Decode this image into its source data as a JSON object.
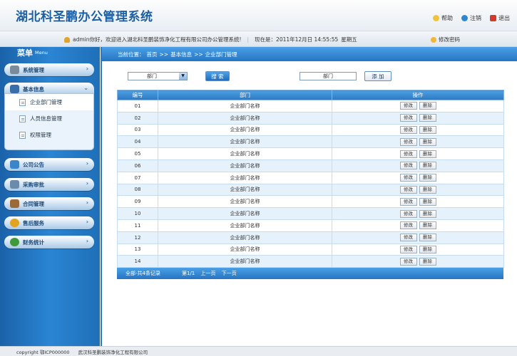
{
  "header": {
    "title": "湖北科圣鹏办公管理系统",
    "links": [
      {
        "label": "帮助",
        "icon": "help-icon"
      },
      {
        "label": "注销",
        "icon": "logout-icon"
      },
      {
        "label": "退出",
        "icon": "exit-icon"
      }
    ]
  },
  "infobar": {
    "welcome": "admin你好，欢迎进入湖北科圣鹏装饰净化工程有限公司办公管理系统!",
    "now_label": "现在是：2011年12月日 14:55:55",
    "weekday": "星期五",
    "change_password": "修改密码"
  },
  "sidebar": {
    "title": "菜单",
    "title_en": "Menu",
    "menus": [
      {
        "label": "系统管理",
        "icon": "gear-icon",
        "color": "#7a8b99"
      },
      {
        "label": "基本信息",
        "icon": "info-icon",
        "color": "#3a6ea8"
      },
      {
        "label": "公司公告",
        "icon": "announcement-icon",
        "color": "#3b86c9"
      },
      {
        "label": "采购审批",
        "icon": "approval-icon",
        "color": "#6b8bad"
      },
      {
        "label": "合同管理",
        "icon": "contract-icon",
        "color": "#9b6a3a"
      },
      {
        "label": "售后服务",
        "icon": "service-icon",
        "color": "#e3a21f"
      },
      {
        "label": "财务统计",
        "icon": "pie-chart-icon",
        "color": "#3f9a3a"
      }
    ],
    "submenu": [
      {
        "label": "企业部门管理"
      },
      {
        "label": "人员信息管理"
      },
      {
        "label": "权限管理"
      }
    ]
  },
  "breadcrumb": {
    "prefix": "当前位置：",
    "items": [
      "首页",
      ">>",
      "基本信息",
      ">>",
      "企业部门管理"
    ]
  },
  "toolbar": {
    "select_value": "部门",
    "select_arrow": "▼",
    "search_label": "搜 索",
    "input_value": "部门",
    "add_label": "添 加"
  },
  "table": {
    "headers": [
      "编号",
      "部门",
      "操作"
    ],
    "edit_label": "修改",
    "delete_label": "删除",
    "rows": [
      {
        "id": "01",
        "name": "企业部门名称"
      },
      {
        "id": "02",
        "name": "企业部门名称"
      },
      {
        "id": "03",
        "name": "企业部门名称"
      },
      {
        "id": "04",
        "name": "企业部门名称"
      },
      {
        "id": "05",
        "name": "企业部门名称"
      },
      {
        "id": "06",
        "name": "企业部门名称"
      },
      {
        "id": "07",
        "name": "企业部门名称"
      },
      {
        "id": "08",
        "name": "企业部门名称"
      },
      {
        "id": "09",
        "name": "企业部门名称"
      },
      {
        "id": "10",
        "name": "企业部门名称"
      },
      {
        "id": "11",
        "name": "企业部门名称"
      },
      {
        "id": "12",
        "name": "企业部门名称"
      },
      {
        "id": "13",
        "name": "企业部门名称"
      },
      {
        "id": "14",
        "name": "企业部门名称"
      }
    ]
  },
  "pager": {
    "total": "全部-共4条记录",
    "page": "第1/1",
    "prev": "上一页",
    "next": "下一页"
  },
  "footer": {
    "copyright": "copyright 鄂ICP000000",
    "company": "武汉科圣鹏装饰净化工程有限公司"
  }
}
